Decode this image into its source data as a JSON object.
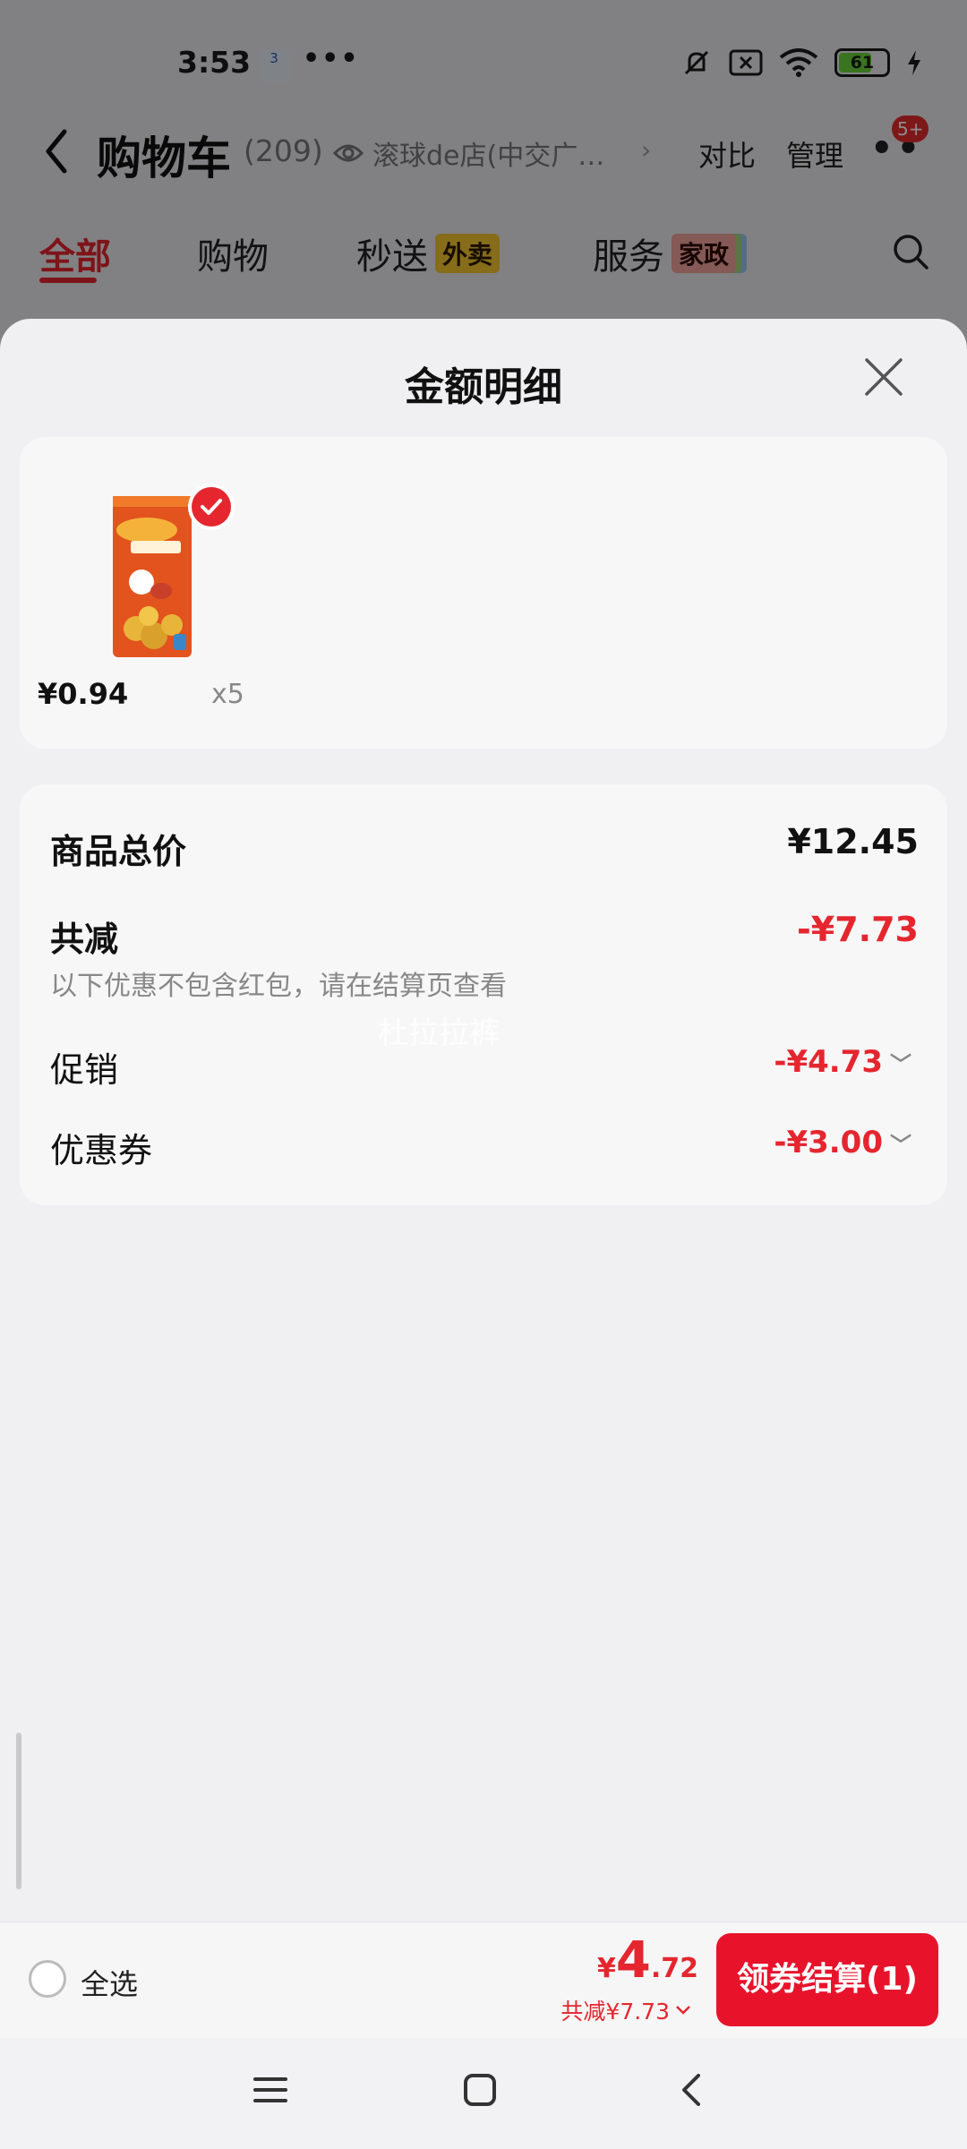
{
  "status_bar": {
    "time": "3:53",
    "notification_icon_text": "3",
    "more_dots": "•••",
    "battery_level": "61",
    "colors": {
      "battery_fill": "#6bd33c"
    }
  },
  "header": {
    "title": "购物车",
    "count": "(209)",
    "store_name": "滚球de店(中交广…",
    "store_arrow": "›",
    "compare": "对比",
    "manage": "管理",
    "more": "••",
    "badge": "5+"
  },
  "tabs": [
    {
      "label": "全部",
      "active": true
    },
    {
      "label": "购物",
      "active": false
    },
    {
      "label": "秒送",
      "tag": "外卖",
      "active": false
    },
    {
      "label": "服务",
      "tag": "家政",
      "active": false
    }
  ],
  "sheet": {
    "title": "金额明细",
    "product": {
      "price": "¥0.94",
      "quantity": "x5",
      "selected": true
    },
    "summary": {
      "total_label": "商品总价",
      "total_value": "¥12.45",
      "discount_label": "共减",
      "discount_value": "-¥7.73",
      "note": "以下优惠不包含红包，请在结算页查看",
      "watermark": "杜拉拉裤",
      "promo_label": "促销",
      "promo_value": "-¥4.73",
      "coupon_label": "优惠券",
      "coupon_value": "-¥3.00"
    }
  },
  "checkout_bar": {
    "select_all_label": "全选",
    "total_currency": "¥",
    "total_integer": "4",
    "total_decimal": ".72",
    "discount_text": "共减¥7.73",
    "checkout_button": "领券结算(1)"
  },
  "theme": {
    "accent_red": "#e5262e",
    "checkout_red": "#e8132b"
  }
}
